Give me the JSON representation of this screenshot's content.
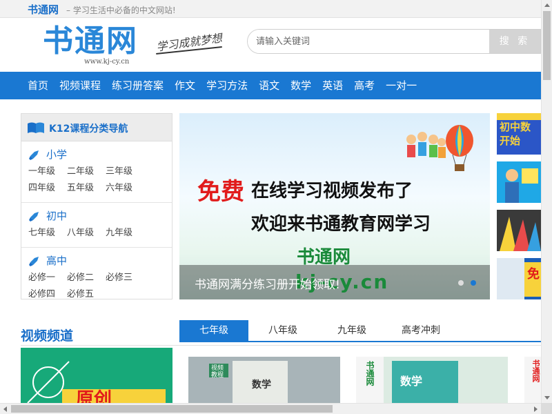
{
  "topbar": {
    "site_name": "书通网",
    "slogan": "– 学习生活中必备的中文网站!"
  },
  "header": {
    "logo_text": "书通网",
    "logo_url": "www.kj-cy.cn",
    "tagline": "学习成就梦想",
    "search": {
      "placeholder": "请输入关键词",
      "button": "搜 索"
    }
  },
  "nav": {
    "items": [
      "首页",
      "视频课程",
      "练习册答案",
      "作文",
      "学习方法",
      "语文",
      "数学",
      "英语",
      "高考",
      "一对一"
    ]
  },
  "catnav": {
    "title": "K12课程分类导航",
    "sections": [
      {
        "name": "小学",
        "grades": [
          "一年级",
          "二年级",
          "三年级",
          "四年级",
          "五年级",
          "六年级"
        ]
      },
      {
        "name": "初中",
        "grades": [
          "七年级",
          "八年级",
          "九年级"
        ]
      },
      {
        "name": "高中",
        "grades": [
          "必修一",
          "必修二",
          "必修三",
          "必修四",
          "必修五"
        ]
      }
    ]
  },
  "banner": {
    "free": "免费",
    "line1": "在线学习视频发布了",
    "line2": "欢迎来书通教育网学习",
    "brand": "书通网",
    "brand_url": "kj-cy.cn",
    "caption": "书通网满分练习册开始领取!",
    "slide_count": 2,
    "active_slide": 2
  },
  "thumbs": [
    {
      "text": "初中数\n开始",
      "bg": "#2b56c7"
    },
    {
      "text": "",
      "bg": "#1fa8e6"
    },
    {
      "text": "",
      "bg": "#3a3a3a"
    },
    {
      "text": "免",
      "bg": "#1b5fb8"
    }
  ],
  "video": {
    "title": "视频频道",
    "tabs": [
      "七年级",
      "八年级",
      "九年级",
      "高考冲刺"
    ],
    "active_tab": 0,
    "big_card_text": "原创",
    "cards": [
      {
        "badge": "视频\n教程",
        "book": "数学"
      },
      {
        "side": "书通网",
        "book": "数学"
      },
      {
        "side": "书通网"
      }
    ]
  },
  "colors": {
    "brand_blue": "#1a78d2",
    "link_blue": "#1a6fc9",
    "free_red": "#e11b1b",
    "green": "#1a8a3a"
  }
}
